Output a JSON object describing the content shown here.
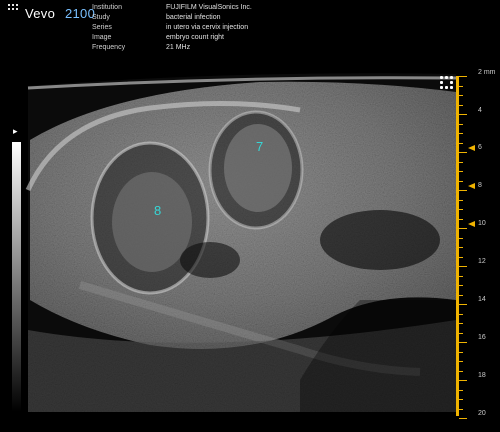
{
  "header": {
    "brand": "Vevo",
    "model": "2100",
    "info": [
      {
        "key": "Institution",
        "value": "FUJIFILM VisualSonics Inc."
      },
      {
        "key": "Study",
        "value": "bacterial infection"
      },
      {
        "key": "Series",
        "value": "in utero via cervix injection"
      },
      {
        "key": "Image",
        "value": "embryo count right"
      },
      {
        "key": "Frequency",
        "value": "21 MHz"
      }
    ]
  },
  "annotations": {
    "embryo_a": "7",
    "embryo_b": "8"
  },
  "depth_scale": {
    "unit_label": "2 mm",
    "labels": [
      "4",
      "6",
      "8",
      "10",
      "12",
      "14",
      "16",
      "18",
      "20"
    ],
    "focus_depths_mm": [
      6,
      8,
      10
    ]
  },
  "icons": {
    "gray_marker": "small-arrow-icon",
    "grid": "grid-dots-icon"
  },
  "colors": {
    "accent_model": "#79c0ff",
    "ruler": "#f0b300",
    "annotation": "#36d6d6"
  }
}
